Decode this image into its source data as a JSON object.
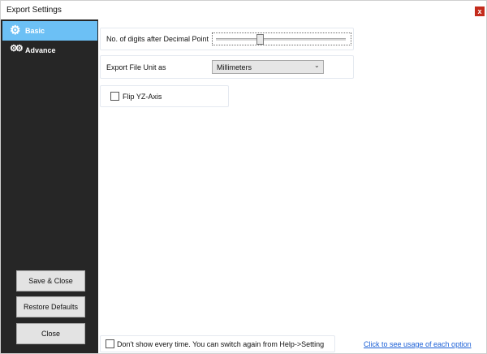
{
  "window": {
    "title": "Export Settings",
    "close_glyph": "x"
  },
  "sidebar": {
    "items": [
      {
        "label": "Basic",
        "icon": "gear-icon",
        "active": true
      },
      {
        "label": "Advance",
        "icon": "gears-icon",
        "active": false
      }
    ],
    "buttons": {
      "save_close": "Save & Close",
      "restore_defaults": "Restore Defaults",
      "close": "Close"
    }
  },
  "basic": {
    "decimal_digits_label": "No. of digits after Decimal Point",
    "decimal_digits_slider_fraction": 0.33,
    "export_unit_label": "Export File Unit as",
    "export_unit_value": "Millimeters",
    "flip_yz_label": "Flip YZ-Axis",
    "flip_yz_checked": false
  },
  "footer": {
    "dont_show_label": "Don't show every time. You can switch again from Help->Setting",
    "dont_show_checked": false,
    "usage_link": "Click to see usage of each option"
  },
  "colors": {
    "sidebar_bg": "#262626",
    "active_item": "#6cc0f5",
    "close_button": "#c42b1c",
    "link": "#1a5fd6"
  }
}
